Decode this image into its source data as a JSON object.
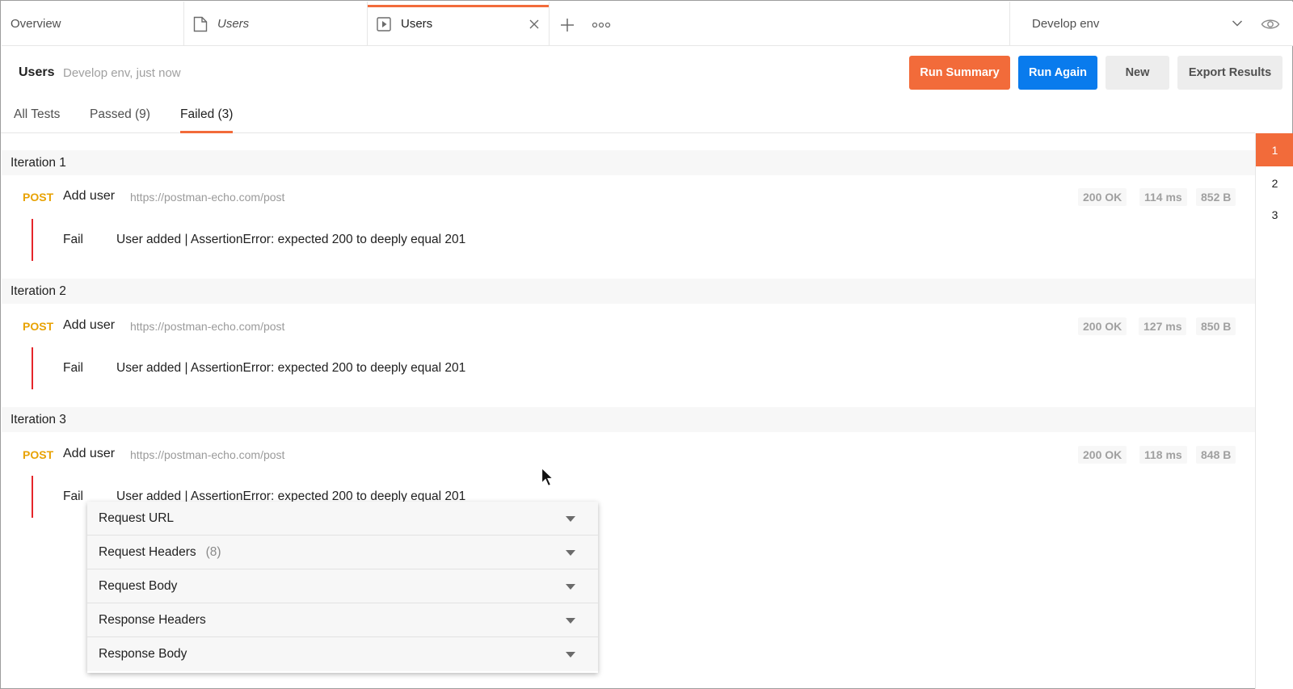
{
  "tabs": {
    "overview": "Overview",
    "users_italic": "Users",
    "users_active": "Users",
    "environment": "Develop env"
  },
  "header": {
    "title": "Users",
    "subtitle": "Develop env, just now",
    "run_summary": "Run Summary",
    "run_again": "Run Again",
    "new": "New",
    "export_results": "Export Results"
  },
  "filter_tabs": {
    "all": "All Tests",
    "passed": "Passed (9)",
    "failed": "Failed (3)"
  },
  "iteration_nav": [
    "1",
    "2",
    "3"
  ],
  "iterations": [
    {
      "title": "Iteration 1",
      "method": "POST",
      "name": "Add user",
      "url": "https://postman-echo.com/post",
      "status": "200 OK",
      "time": "114 ms",
      "size": "852 B",
      "result": "Fail",
      "message": "User added | AssertionError: expected 200 to deeply equal 201"
    },
    {
      "title": "Iteration 2",
      "method": "POST",
      "name": "Add user",
      "url": "https://postman-echo.com/post",
      "status": "200 OK",
      "time": "127 ms",
      "size": "850 B",
      "result": "Fail",
      "message": "User added | AssertionError: expected 200 to deeply equal 201"
    },
    {
      "title": "Iteration 3",
      "method": "POST",
      "name": "Add user",
      "url": "https://postman-echo.com/post",
      "status": "200 OK",
      "time": "118 ms",
      "size": "848 B",
      "result": "Fail",
      "message": "User added | AssertionError: expected 200 to deeply equal 201"
    }
  ],
  "details_panel": {
    "request_url": "Request URL",
    "request_headers": "Request Headers",
    "request_headers_count": "(8)",
    "request_body": "Request Body",
    "response_headers": "Response Headers",
    "response_body": "Response Body"
  },
  "colors": {
    "accent": "#f26b3a",
    "primary": "#097bed",
    "post_method": "#e8a203",
    "fail": "#e5262a"
  }
}
